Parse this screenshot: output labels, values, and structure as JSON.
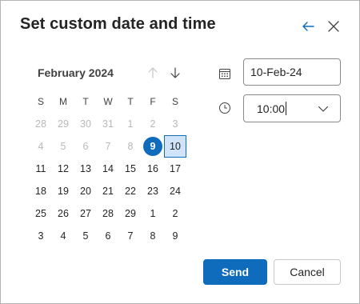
{
  "dialog": {
    "title": "Set custom date and time"
  },
  "calendar": {
    "month_label": "February 2024",
    "weekdays": [
      "S",
      "M",
      "T",
      "W",
      "T",
      "F",
      "S"
    ],
    "weeks": [
      [
        {
          "d": "28",
          "muted": true
        },
        {
          "d": "29",
          "muted": true
        },
        {
          "d": "30",
          "muted": true
        },
        {
          "d": "31",
          "muted": true
        },
        {
          "d": "1",
          "muted": true
        },
        {
          "d": "2",
          "muted": true
        },
        {
          "d": "3",
          "muted": true
        }
      ],
      [
        {
          "d": "4",
          "muted": true
        },
        {
          "d": "5",
          "muted": true
        },
        {
          "d": "6",
          "muted": true
        },
        {
          "d": "7",
          "muted": true
        },
        {
          "d": "8",
          "muted": true
        },
        {
          "d": "9",
          "today": true
        },
        {
          "d": "10",
          "selected": true
        }
      ],
      [
        {
          "d": "11"
        },
        {
          "d": "12"
        },
        {
          "d": "13"
        },
        {
          "d": "14"
        },
        {
          "d": "15"
        },
        {
          "d": "16"
        },
        {
          "d": "17"
        }
      ],
      [
        {
          "d": "18"
        },
        {
          "d": "19"
        },
        {
          "d": "20"
        },
        {
          "d": "21"
        },
        {
          "d": "22"
        },
        {
          "d": "23"
        },
        {
          "d": "24"
        }
      ],
      [
        {
          "d": "25"
        },
        {
          "d": "26"
        },
        {
          "d": "27"
        },
        {
          "d": "28"
        },
        {
          "d": "29"
        },
        {
          "d": "1"
        },
        {
          "d": "2"
        }
      ],
      [
        {
          "d": "3"
        },
        {
          "d": "4"
        },
        {
          "d": "5"
        },
        {
          "d": "6"
        },
        {
          "d": "7"
        },
        {
          "d": "8"
        },
        {
          "d": "9"
        }
      ]
    ]
  },
  "fields": {
    "date_value": "10-Feb-24",
    "time_value": "10:00"
  },
  "actions": {
    "send_label": "Send",
    "cancel_label": "Cancel"
  },
  "icons": {
    "back": "arrow-left-icon",
    "close": "close-icon",
    "prev_month": "arrow-up-icon",
    "next_month": "arrow-down-icon",
    "date": "calendar-icon",
    "time": "clock-icon",
    "dropdown": "chevron-down-icon"
  },
  "colors": {
    "accent": "#0f6cbd",
    "selected_bg": "#cfe4fa",
    "muted_text": "#b8b8b8"
  }
}
